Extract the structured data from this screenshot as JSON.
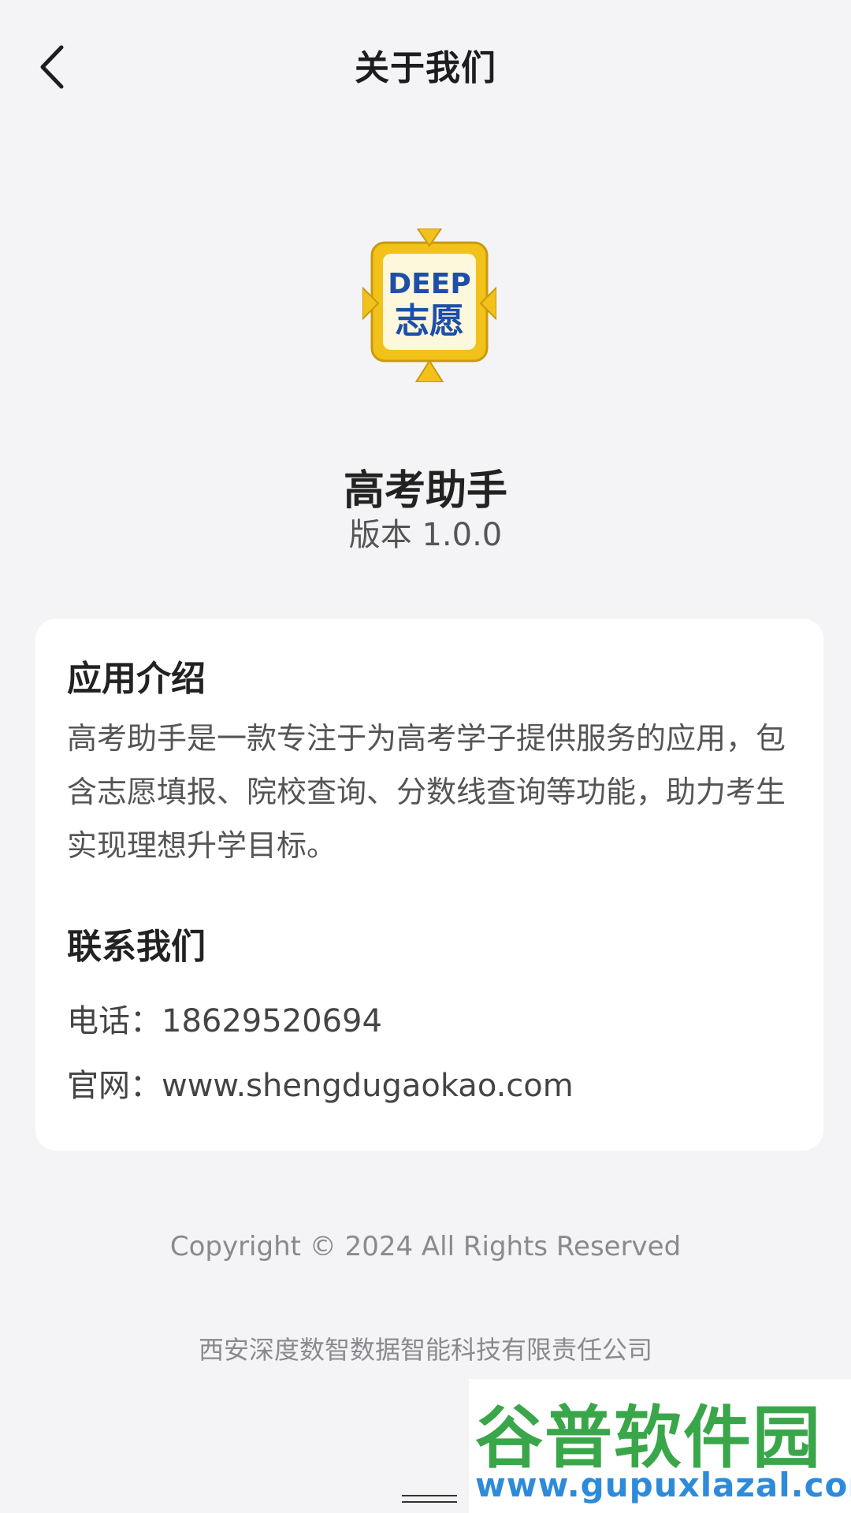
{
  "header": {
    "title": "关于我们",
    "back_icon": "chevron-left-icon"
  },
  "app": {
    "logo_text_top": "DEEP",
    "logo_text_bottom": "志愿",
    "name": "高考助手",
    "version": "版本 1.0.0"
  },
  "card": {
    "intro_title": "应用介绍",
    "intro_lines": [
      "高考助手是一款专注于为高考学子提供服务的应用，包",
      "含志愿填报、院校查询、分数线查询等功能，助力考生",
      "实现理想升学目标。"
    ],
    "contact_title": "联系我们",
    "phone": "电话：18629520694",
    "website": "官网：www.shengdugaokao.com"
  },
  "footer": {
    "copyright": "Copyright © 2024 All Rights Reserved",
    "company": "西安深度数智数据智能科技有限责任公司"
  },
  "watermark": {
    "title": "谷普软件园",
    "url": "www.gupuxlazal.com"
  },
  "colors": {
    "background": "#f4f4f6",
    "card": "#ffffff",
    "logo_gold": "#f2c21b",
    "logo_blue": "#1e4fa8",
    "watermark_green": "#3aa64a",
    "watermark_blue": "#2e8bd9"
  }
}
